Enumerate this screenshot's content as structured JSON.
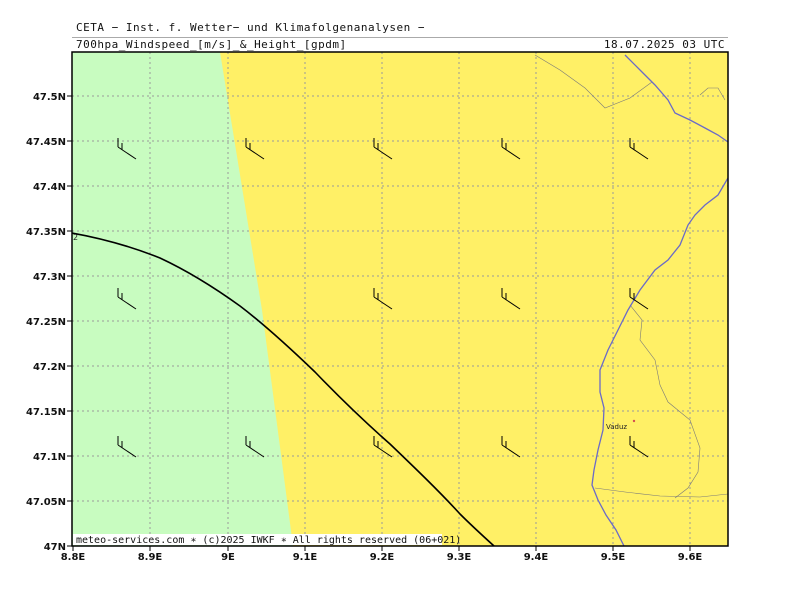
{
  "header": {
    "title": "CETA − Inst. f. Wetter− und Klimafolgenanalysen −",
    "subtitle": "700hpa_Windspeed_[m/s]_&_Height_[gpdm]",
    "datetime": "18.07.2025 03 UTC"
  },
  "footer": {
    "credit": "meteo-services.com ∗ (c)2025 IWKF ∗ All rights reserved (06+021)"
  },
  "map": {
    "x_ticks": [
      "8.8E",
      "8.9E",
      "9E",
      "9.1E",
      "9.2E",
      "9.3E",
      "9.4E",
      "9.5E",
      "9.6E"
    ],
    "y_ticks": [
      "47N",
      "47.05N",
      "47.1N",
      "47.15N",
      "47.2N",
      "47.25N",
      "47.3N",
      "47.35N",
      "47.4N",
      "47.45N",
      "47.5N"
    ],
    "lon_range": [
      8.8,
      9.65
    ],
    "lat_range": [
      47.0,
      47.55
    ],
    "place_label": "Vaduz",
    "contour_label": "2",
    "colors": {
      "zone_light_green": "#c8fcc0",
      "zone_yellow": "#fff066",
      "border": "#6a6ac8",
      "contour": "#000000",
      "grid": "#9a9a9a"
    }
  }
}
